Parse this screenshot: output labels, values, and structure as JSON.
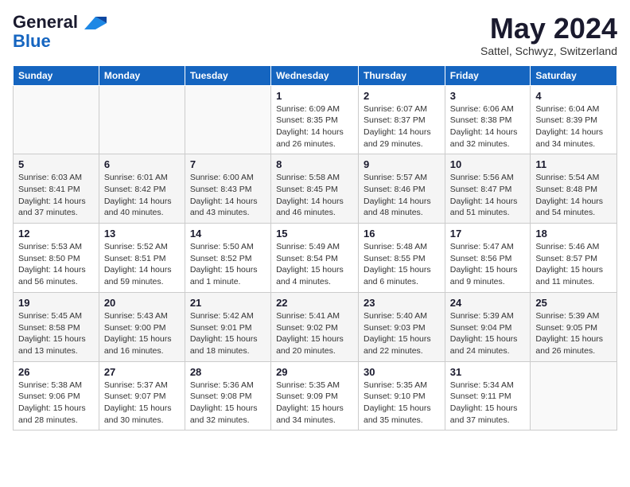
{
  "header": {
    "logo_line1": "General",
    "logo_line2": "Blue",
    "month": "May 2024",
    "location": "Sattel, Schwyz, Switzerland"
  },
  "days_of_week": [
    "Sunday",
    "Monday",
    "Tuesday",
    "Wednesday",
    "Thursday",
    "Friday",
    "Saturday"
  ],
  "weeks": [
    [
      {
        "day": "",
        "info": ""
      },
      {
        "day": "",
        "info": ""
      },
      {
        "day": "",
        "info": ""
      },
      {
        "day": "1",
        "info": "Sunrise: 6:09 AM\nSunset: 8:35 PM\nDaylight: 14 hours\nand 26 minutes."
      },
      {
        "day": "2",
        "info": "Sunrise: 6:07 AM\nSunset: 8:37 PM\nDaylight: 14 hours\nand 29 minutes."
      },
      {
        "day": "3",
        "info": "Sunrise: 6:06 AM\nSunset: 8:38 PM\nDaylight: 14 hours\nand 32 minutes."
      },
      {
        "day": "4",
        "info": "Sunrise: 6:04 AM\nSunset: 8:39 PM\nDaylight: 14 hours\nand 34 minutes."
      }
    ],
    [
      {
        "day": "5",
        "info": "Sunrise: 6:03 AM\nSunset: 8:41 PM\nDaylight: 14 hours\nand 37 minutes."
      },
      {
        "day": "6",
        "info": "Sunrise: 6:01 AM\nSunset: 8:42 PM\nDaylight: 14 hours\nand 40 minutes."
      },
      {
        "day": "7",
        "info": "Sunrise: 6:00 AM\nSunset: 8:43 PM\nDaylight: 14 hours\nand 43 minutes."
      },
      {
        "day": "8",
        "info": "Sunrise: 5:58 AM\nSunset: 8:45 PM\nDaylight: 14 hours\nand 46 minutes."
      },
      {
        "day": "9",
        "info": "Sunrise: 5:57 AM\nSunset: 8:46 PM\nDaylight: 14 hours\nand 48 minutes."
      },
      {
        "day": "10",
        "info": "Sunrise: 5:56 AM\nSunset: 8:47 PM\nDaylight: 14 hours\nand 51 minutes."
      },
      {
        "day": "11",
        "info": "Sunrise: 5:54 AM\nSunset: 8:48 PM\nDaylight: 14 hours\nand 54 minutes."
      }
    ],
    [
      {
        "day": "12",
        "info": "Sunrise: 5:53 AM\nSunset: 8:50 PM\nDaylight: 14 hours\nand 56 minutes."
      },
      {
        "day": "13",
        "info": "Sunrise: 5:52 AM\nSunset: 8:51 PM\nDaylight: 14 hours\nand 59 minutes."
      },
      {
        "day": "14",
        "info": "Sunrise: 5:50 AM\nSunset: 8:52 PM\nDaylight: 15 hours\nand 1 minute."
      },
      {
        "day": "15",
        "info": "Sunrise: 5:49 AM\nSunset: 8:54 PM\nDaylight: 15 hours\nand 4 minutes."
      },
      {
        "day": "16",
        "info": "Sunrise: 5:48 AM\nSunset: 8:55 PM\nDaylight: 15 hours\nand 6 minutes."
      },
      {
        "day": "17",
        "info": "Sunrise: 5:47 AM\nSunset: 8:56 PM\nDaylight: 15 hours\nand 9 minutes."
      },
      {
        "day": "18",
        "info": "Sunrise: 5:46 AM\nSunset: 8:57 PM\nDaylight: 15 hours\nand 11 minutes."
      }
    ],
    [
      {
        "day": "19",
        "info": "Sunrise: 5:45 AM\nSunset: 8:58 PM\nDaylight: 15 hours\nand 13 minutes."
      },
      {
        "day": "20",
        "info": "Sunrise: 5:43 AM\nSunset: 9:00 PM\nDaylight: 15 hours\nand 16 minutes."
      },
      {
        "day": "21",
        "info": "Sunrise: 5:42 AM\nSunset: 9:01 PM\nDaylight: 15 hours\nand 18 minutes."
      },
      {
        "day": "22",
        "info": "Sunrise: 5:41 AM\nSunset: 9:02 PM\nDaylight: 15 hours\nand 20 minutes."
      },
      {
        "day": "23",
        "info": "Sunrise: 5:40 AM\nSunset: 9:03 PM\nDaylight: 15 hours\nand 22 minutes."
      },
      {
        "day": "24",
        "info": "Sunrise: 5:39 AM\nSunset: 9:04 PM\nDaylight: 15 hours\nand 24 minutes."
      },
      {
        "day": "25",
        "info": "Sunrise: 5:39 AM\nSunset: 9:05 PM\nDaylight: 15 hours\nand 26 minutes."
      }
    ],
    [
      {
        "day": "26",
        "info": "Sunrise: 5:38 AM\nSunset: 9:06 PM\nDaylight: 15 hours\nand 28 minutes."
      },
      {
        "day": "27",
        "info": "Sunrise: 5:37 AM\nSunset: 9:07 PM\nDaylight: 15 hours\nand 30 minutes."
      },
      {
        "day": "28",
        "info": "Sunrise: 5:36 AM\nSunset: 9:08 PM\nDaylight: 15 hours\nand 32 minutes."
      },
      {
        "day": "29",
        "info": "Sunrise: 5:35 AM\nSunset: 9:09 PM\nDaylight: 15 hours\nand 34 minutes."
      },
      {
        "day": "30",
        "info": "Sunrise: 5:35 AM\nSunset: 9:10 PM\nDaylight: 15 hours\nand 35 minutes."
      },
      {
        "day": "31",
        "info": "Sunrise: 5:34 AM\nSunset: 9:11 PM\nDaylight: 15 hours\nand 37 minutes."
      },
      {
        "day": "",
        "info": ""
      }
    ]
  ]
}
